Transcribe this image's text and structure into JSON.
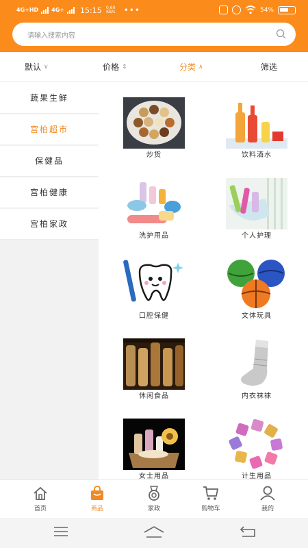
{
  "status_bar": {
    "network1": "4G+HD",
    "network2": "4G+",
    "time": "15:15",
    "speed": "0.60 KB/s",
    "more": "•••",
    "battery": "54%"
  },
  "search": {
    "placeholder": "请输入搜索内容"
  },
  "filters": [
    {
      "label": "默认",
      "arrow": "∨"
    },
    {
      "label": "价格",
      "arrow": "⇕"
    },
    {
      "label": "分类",
      "arrow": "∧"
    },
    {
      "label": "筛选",
      "arrow": ""
    }
  ],
  "categories": [
    {
      "label": "蔬果生鲜"
    },
    {
      "label": "宫柏超市"
    },
    {
      "label": "保健品"
    },
    {
      "label": "宫柏健康"
    },
    {
      "label": "宫柏家政"
    }
  ],
  "products": [
    {
      "label": "炒货"
    },
    {
      "label": "饮料酒水"
    },
    {
      "label": "洗护用品"
    },
    {
      "label": "个人护理"
    },
    {
      "label": "口腔保健"
    },
    {
      "label": "文体玩具"
    },
    {
      "label": "休闲食品"
    },
    {
      "label": "内衣袜袜"
    },
    {
      "label": "女士用品"
    },
    {
      "label": "计生用品"
    }
  ],
  "tabbar": [
    {
      "label": "首页",
      "icon": "home-icon"
    },
    {
      "label": "商品",
      "icon": "shopping-bag-icon"
    },
    {
      "label": "家政",
      "icon": "medal-icon"
    },
    {
      "label": "购物车",
      "icon": "cart-icon"
    },
    {
      "label": "我的",
      "icon": "person-icon"
    }
  ],
  "colors": {
    "accent": "#fb8c1c",
    "active_text": "#f08a24"
  }
}
